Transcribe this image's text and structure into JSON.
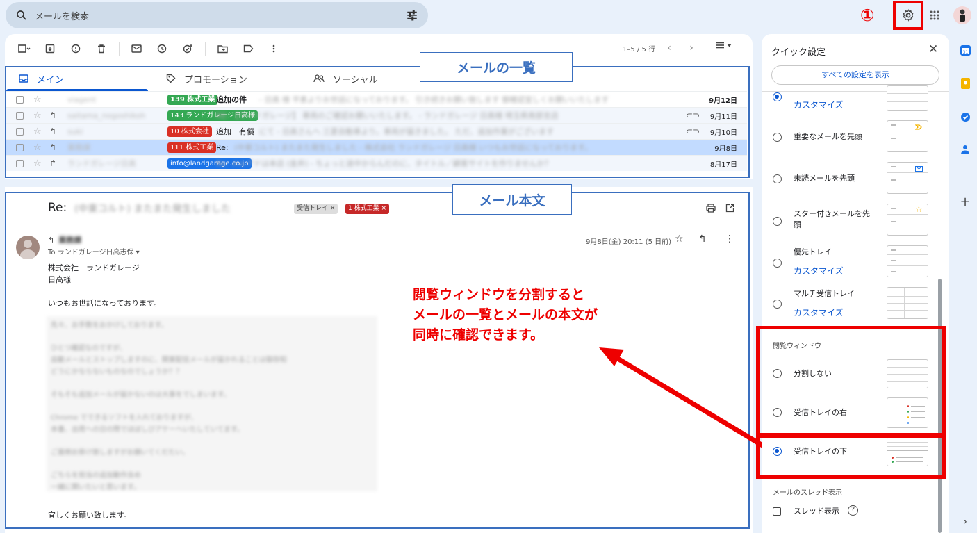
{
  "search": {
    "placeholder": "メールを検索"
  },
  "annotation": {
    "circled_number": "①"
  },
  "toolbar": {
    "pager": "1–5 / 5 行"
  },
  "tabs": [
    {
      "label": "メイン"
    },
    {
      "label": "プロモーション"
    },
    {
      "label": "ソーシャル"
    }
  ],
  "rows": [
    {
      "sender": "viagent",
      "badge": "139 株式工業",
      "badge_color": "#34a853",
      "subject": "追加の件",
      "snippet": "- 日高 様 平素よりお世話になっております。 引き続きお願い致します 御確認宜しくお願いいたします",
      "clip": false,
      "date": "9月12日",
      "unread": true,
      "selected": false,
      "fwd": ""
    },
    {
      "sender": "saitama_nogoshikoh",
      "badge": "143 ランドガレージ日高様",
      "badge_color": "#34a853",
      "subject": "",
      "snippet": "RE: 【ランドガレージ】 車両のご確認お願いいたします。 - ランドガレージ 日高様 埼玉県南部支店",
      "clip": true,
      "date": "9月11日",
      "unread": false,
      "selected": false,
      "fwd": "↰"
    },
    {
      "sender": "suki",
      "badge": "10 株式会社",
      "badge_color": "#d93025",
      "subject": "追加　有償",
      "snippet": "にて - 日高さんへ 三菱自動車より。車両が届きました。 ただ、追加作業がございます",
      "clip": true,
      "date": "9月10日",
      "unread": false,
      "selected": false,
      "fwd": "↰"
    },
    {
      "sender": "業務課",
      "badge": "111 株式工業",
      "badge_color": "#d93025",
      "subject": "Re:",
      "snippet": "(中東コルト) またまた発生しました - 株式会社 ランドガレージ 日高様 いつもお世話になっております。",
      "clip": false,
      "date": "9月8日",
      "unread": false,
      "selected": true,
      "fwd": "↰"
    },
    {
      "sender": "ランドガレージ日高",
      "badge": "info@landgarage.co.jp",
      "badge_color": "#1a73e8",
      "subject": "",
      "snippet": "Re: メルアドは本店 (金井) - ちょっと途中からんだのに、タイトル／顧客サイトを作りませんか？",
      "clip": false,
      "date": "8月17日",
      "unread": false,
      "selected": false,
      "fwd": "↱"
    }
  ],
  "callouts": {
    "list": "メールの一覧",
    "body": "メール本文"
  },
  "mail": {
    "subject": "Re:",
    "subject_blur": "(中東コルト) またまた発生しました",
    "chip_inbox": "受信トレイ ×",
    "chip_label": "1 株式工業 ×",
    "from": "業務課",
    "to": "To ランドガレージ日高志保 ▾",
    "date": "9月8日(金) 20:11 (5 日前)",
    "line1": "株式会社　ランドガレージ",
    "line2": "日高様",
    "greeting": "いつもお世話になっております。",
    "blurred": [
      "先々、お手数をおかけしております。",
      "",
      "ひとつ確認なのですが、",
      "自動メールとストップしますのに、関東配信メールが届かれることは御存知",
      "どうにかならないものなのでしょうか？？",
      "",
      "そもそも追加メールが届かないのは大事をでしまいます。",
      "",
      "Chrome でできるソフトを入れておりますが、",
      "本番、出荷への日の際でほぼしびアケーヘいたしていてます。",
      "",
      "ご面倒お掛け致しますがお願いてくだたい。",
      "",
      "ごちらを担当の追加動作含め",
      "一緒に関いたいと思います。"
    ],
    "closing": "宜しくお願い致します。"
  },
  "note": {
    "line1": "閲覧ウィンドウを分割すると",
    "line2": "メールの一覧とメールの本文が",
    "line3": "同時に確認できます。"
  },
  "quick_settings": {
    "title": "クイック設定",
    "all_settings": "すべての設定を表示",
    "options": [
      {
        "label": "",
        "sub": "カスタマイズ"
      },
      {
        "label": "重要なメールを先頭",
        "sub": ""
      },
      {
        "label": "未読メールを先頭",
        "sub": ""
      },
      {
        "label": "スター付きメールを先頭",
        "sub": ""
      },
      {
        "label": "優先トレイ",
        "sub": "カスタマイズ"
      },
      {
        "label": "マルチ受信トレイ",
        "sub": "カスタマイズ"
      }
    ],
    "reading_pane_label": "閲覧ウィンドウ",
    "reading_pane": [
      {
        "label": "分割しない",
        "selected": false
      },
      {
        "label": "受信トレイの右",
        "selected": false
      },
      {
        "label": "受信トレイの下",
        "selected": true
      }
    ],
    "thread_label": "メールのスレッド表示",
    "thread_option": "スレッド表示"
  },
  "colors": {
    "accent": "#0b57d0",
    "annotation_red": "#ee0000",
    "annotation_blue": "#3a6fbf"
  }
}
